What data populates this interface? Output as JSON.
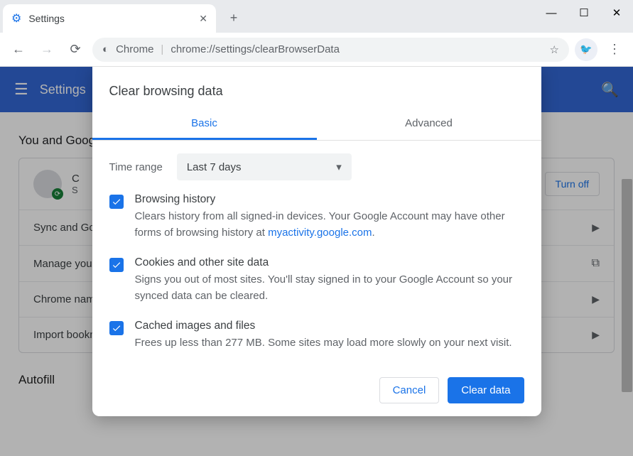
{
  "window": {
    "tab_title": "Settings",
    "minimize": "―",
    "maximize": "☐",
    "close": "✕"
  },
  "toolbar": {
    "omnibox_prefix": "Chrome",
    "omnibox_url": "chrome://settings/clearBrowserData"
  },
  "appbar": {
    "title": "Settings"
  },
  "page": {
    "section1_title": "You and Google",
    "profile_line1": "C",
    "profile_line2": "S",
    "turn_off": "Turn off",
    "rows": [
      "Sync and Google services",
      "Manage your Google Account",
      "Chrome name and picture",
      "Import bookmarks and settings"
    ],
    "section2_title": "Autofill"
  },
  "dialog": {
    "title": "Clear browsing data",
    "tabs": {
      "basic": "Basic",
      "advanced": "Advanced"
    },
    "time_range_label": "Time range",
    "time_range_value": "Last 7 days",
    "options": [
      {
        "title": "Browsing history",
        "desc_a": "Clears history from all signed-in devices. Your Google Account may have other forms of browsing history at ",
        "link": "myactivity.google.com",
        "desc_b": "."
      },
      {
        "title": "Cookies and other site data",
        "desc_a": "Signs you out of most sites. You'll stay signed in to your Google Account so your synced data can be cleared."
      },
      {
        "title": "Cached images and files",
        "desc_a": "Frees up less than 277 MB. Some sites may load more slowly on your next visit."
      }
    ],
    "cancel": "Cancel",
    "clear": "Clear data"
  }
}
